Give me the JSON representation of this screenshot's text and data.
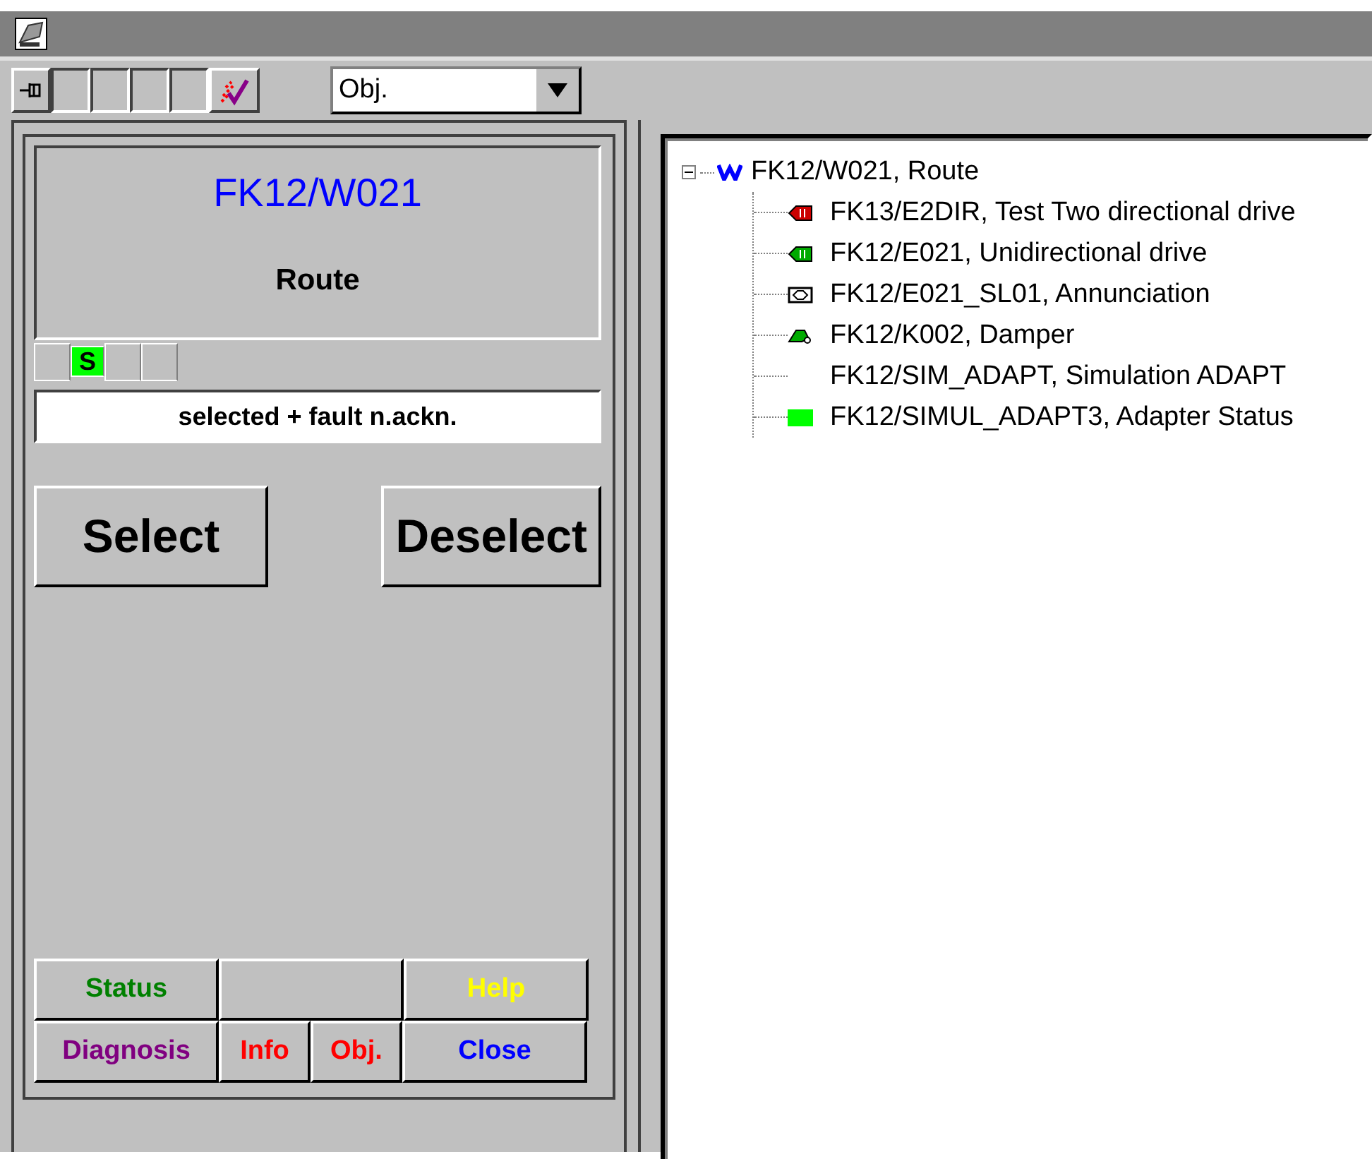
{
  "toolbar": {
    "dropdown": {
      "value": "Obj."
    }
  },
  "faceplate": {
    "title": "FK12/W021",
    "subtitle": "Route",
    "indicator": {
      "label": "S",
      "on": true
    },
    "status_text": "selected + fault n.ackn."
  },
  "actions": [
    "Select",
    "Deselect"
  ],
  "bottom_buttons": [
    {
      "kind": "button",
      "label": "Status",
      "color": "#008000"
    },
    {
      "kind": "blank"
    },
    {
      "kind": "button",
      "label": "Help",
      "color": "#ffff00"
    },
    {
      "kind": "button",
      "label": "Diagnosis",
      "color": "#800080"
    },
    {
      "kind": "button",
      "label": "Info",
      "color": "#ff0000"
    },
    {
      "kind": "button",
      "label": "Obj.",
      "color": "#ff0000"
    },
    {
      "kind": "button",
      "label": "Close",
      "color": "#0000ff"
    }
  ],
  "tree": {
    "label": "FK12/W021,  Route",
    "expanded": true,
    "children": [
      {
        "label": "FK13/E2DIR,  Test Two directional drive",
        "kind": "drive",
        "color": "#cc0000"
      },
      {
        "label": "FK12/E021,  Unidirectional drive",
        "kind": "drive",
        "color": "#00aa00"
      },
      {
        "label": "FK12/E021_SL01,  Annunciation",
        "kind": "annunciation"
      },
      {
        "label": "FK12/K002,  Damper",
        "kind": "damper",
        "color": "#00aa00"
      },
      {
        "label": "FK12/SIM_ADAPT,  Simulation ADAPT",
        "kind": "none"
      },
      {
        "label": "FK12/SIMUL_ADAPT3,  Adapter Status",
        "kind": "square",
        "color": "#00ff00"
      }
    ]
  }
}
